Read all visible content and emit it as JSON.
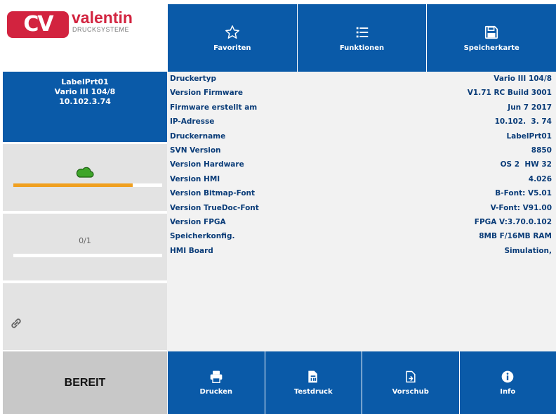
{
  "logo": {
    "mark": "CV",
    "brand": "valentin",
    "subtitle": "DRUCKSYSTEME"
  },
  "device": {
    "name": "LabelPrt01",
    "model": "Vario III 104/8",
    "ip": "10.102.3.74"
  },
  "progress": {
    "ribbon_fill": 0.8,
    "count": "0/1",
    "count_fill": 0.0
  },
  "status": "BEREIT",
  "tabs": [
    {
      "label": "Favoriten",
      "icon": "star-icon"
    },
    {
      "label": "Funktionen",
      "icon": "list-icon"
    },
    {
      "label": "Speicherkarte",
      "icon": "save-icon"
    }
  ],
  "info_rows": [
    {
      "key": "Druckertyp",
      "value": "Vario III 104/8"
    },
    {
      "key": "Version Firmware",
      "value": "V1.71 RC Build 3001"
    },
    {
      "key": "Firmware erstellt am",
      "value": "Jun  7 2017"
    },
    {
      "key": "IP-Adresse",
      "value": "10.102.  3. 74"
    },
    {
      "key": "Druckername",
      "value": "LabelPrt01"
    },
    {
      "key": "SVN Version",
      "value": "8850"
    },
    {
      "key": "Version Hardware",
      "value": "OS 2  HW 32"
    },
    {
      "key": "Version HMI",
      "value": "4.026"
    },
    {
      "key": "Version Bitmap-Font",
      "value": "B-Font: V5.01"
    },
    {
      "key": "Version TrueDoc-Font",
      "value": "V-Font: V91.00"
    },
    {
      "key": "Version FPGA",
      "value": "FPGA V:3.70.0.102"
    },
    {
      "key": "Speicherkonfig.",
      "value": "8MB F/16MB RAM"
    },
    {
      "key": "HMI Board",
      "value": "Simulation,"
    }
  ],
  "buttons": [
    {
      "label": "Drucken",
      "icon": "printer-icon"
    },
    {
      "label": "Testdruck",
      "icon": "test-print-icon"
    },
    {
      "label": "Vorschub",
      "icon": "feed-icon"
    },
    {
      "label": "Info",
      "icon": "info-icon"
    }
  ],
  "colors": {
    "primary": "#0a5aa8",
    "brand": "#d2233f",
    "progress": "#f0a020",
    "cloud": "#3fa52a"
  }
}
